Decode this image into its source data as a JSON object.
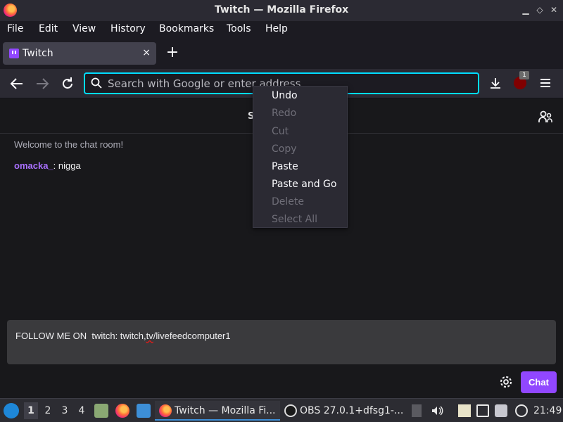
{
  "window": {
    "title": "Twitch — Mozilla Firefox"
  },
  "menubar": {
    "items": [
      "File",
      "Edit",
      "View",
      "History",
      "Bookmarks",
      "Tools",
      "Help"
    ]
  },
  "tabs": [
    {
      "label": "Twitch",
      "close": "×"
    }
  ],
  "newtab_label": "+",
  "urlbar": {
    "placeholder": "Search with Google or enter address",
    "value": ""
  },
  "extensions": {
    "ublock_badge": "1"
  },
  "page": {
    "header_text": "S",
    "welcome": "Welcome to the chat room!",
    "message": {
      "user": "omacka_",
      "sep": ": ",
      "text": "nigga"
    },
    "input": {
      "prefix": "FOLLOW ME ON  twitch: twitch,",
      "misspelled": "tv",
      "suffix": "/livefeedcomputer1"
    },
    "chat_button": "Chat"
  },
  "context_menu": {
    "items": [
      {
        "label": "Undo",
        "enabled": true
      },
      {
        "label": "Redo",
        "enabled": false
      },
      {
        "label": "Cut",
        "enabled": false
      },
      {
        "label": "Copy",
        "enabled": false
      },
      {
        "label": "Paste",
        "enabled": true
      },
      {
        "label": "Paste and Go",
        "enabled": true
      },
      {
        "label": "Delete",
        "enabled": false
      },
      {
        "label": "Select All",
        "enabled": false
      }
    ]
  },
  "taskbar": {
    "workspaces": [
      "1",
      "2",
      "3",
      "4"
    ],
    "active_workspace": "1",
    "tasks": [
      {
        "label": "Twitch — Mozilla Fi...",
        "active": true
      },
      {
        "label": "OBS 27.0.1+dfsg1-...",
        "active": false
      }
    ],
    "clock": "21:49"
  },
  "colors": {
    "accent": "#00ddff",
    "twitch_purple": "#9147ff",
    "username": "#a970ff"
  }
}
